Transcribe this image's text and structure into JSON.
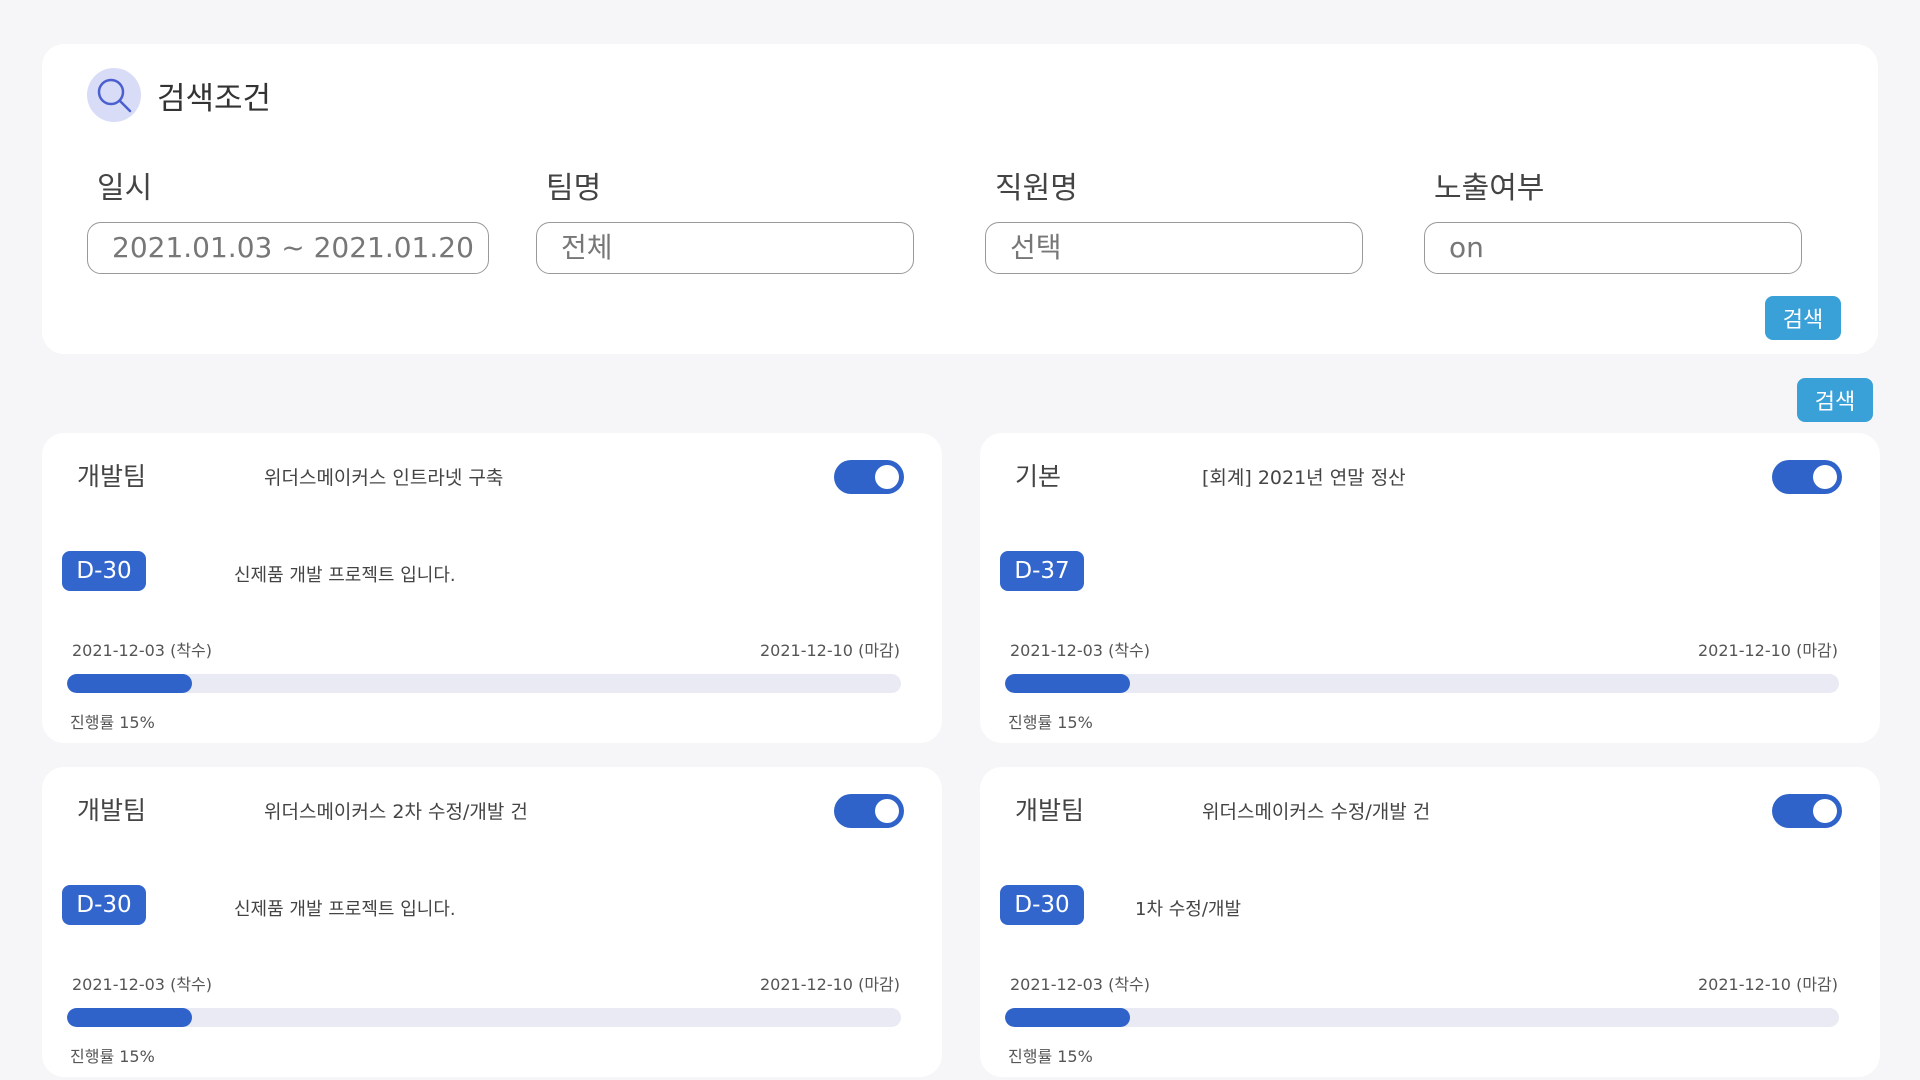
{
  "search": {
    "title": "검색조건",
    "fields": [
      {
        "label": "일시",
        "value": "2021.01.03 ~ 2021.01.20"
      },
      {
        "label": "팀명",
        "value": "전체"
      },
      {
        "label": "직원명",
        "value": "선택"
      },
      {
        "label": "노출여부",
        "value": "on"
      }
    ],
    "button_label": "검색"
  },
  "list_search_button": "검색",
  "colors": {
    "accent_blue": "#2f63c9",
    "button_blue": "#3aa1d8",
    "background": "#f6f6f8"
  },
  "projects": [
    {
      "team": "개발팀",
      "title": "위더스메이커스 인트라넷 구축",
      "toggle_on": true,
      "dday": "D-30",
      "description": "신제품 개발 프로젝트 입니다.",
      "start": "2021-12-03 (착수)",
      "end": "2021-12-10 (마감)",
      "progress": 15,
      "progress_label": "진행률 15%"
    },
    {
      "team": "기본",
      "title": "[회계] 2021년 연말 정산",
      "toggle_on": true,
      "dday": "D-37",
      "description": "",
      "start": "2021-12-03 (착수)",
      "end": "2021-12-10 (마감)",
      "progress": 15,
      "progress_label": "진행률 15%"
    },
    {
      "team": "개발팀",
      "title": "위더스메이커스 2차 수정/개발 건",
      "toggle_on": true,
      "dday": "D-30",
      "description": "신제품 개발 프로젝트 입니다.",
      "start": "2021-12-03 (착수)",
      "end": "2021-12-10 (마감)",
      "progress": 15,
      "progress_label": "진행률 15%"
    },
    {
      "team": "개발팀",
      "title": "위더스메이커스 수정/개발 건",
      "toggle_on": true,
      "dday": "D-30",
      "description": "1차 수정/개발",
      "start": "2021-12-03 (착수)",
      "end": "2021-12-10 (마감)",
      "progress": 15,
      "progress_label": "진행률 15%"
    }
  ]
}
